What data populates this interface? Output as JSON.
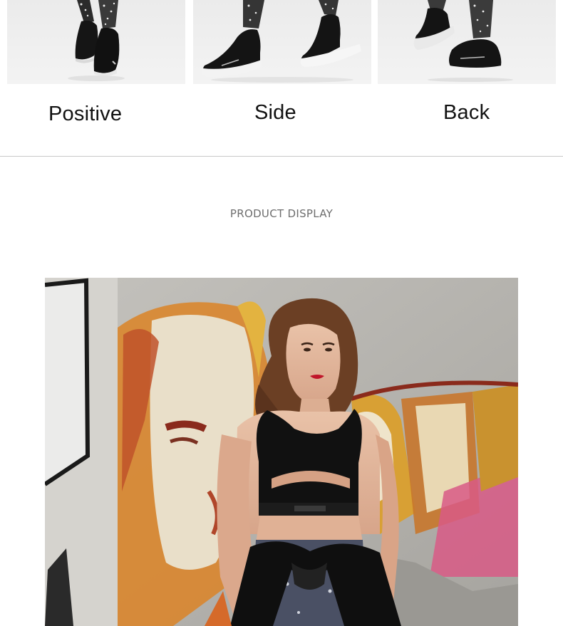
{
  "views": [
    {
      "label": "Positive"
    },
    {
      "label": "Side"
    },
    {
      "label": "Back"
    }
  ],
  "section": {
    "title": "PRODUCT DISPLAY"
  },
  "colors": {
    "thumb_background": "#efefef",
    "shoe": "#141414",
    "sole": "#f4f4f4",
    "divider": "#c9c9c9",
    "section_title": "#6e6e6e"
  }
}
